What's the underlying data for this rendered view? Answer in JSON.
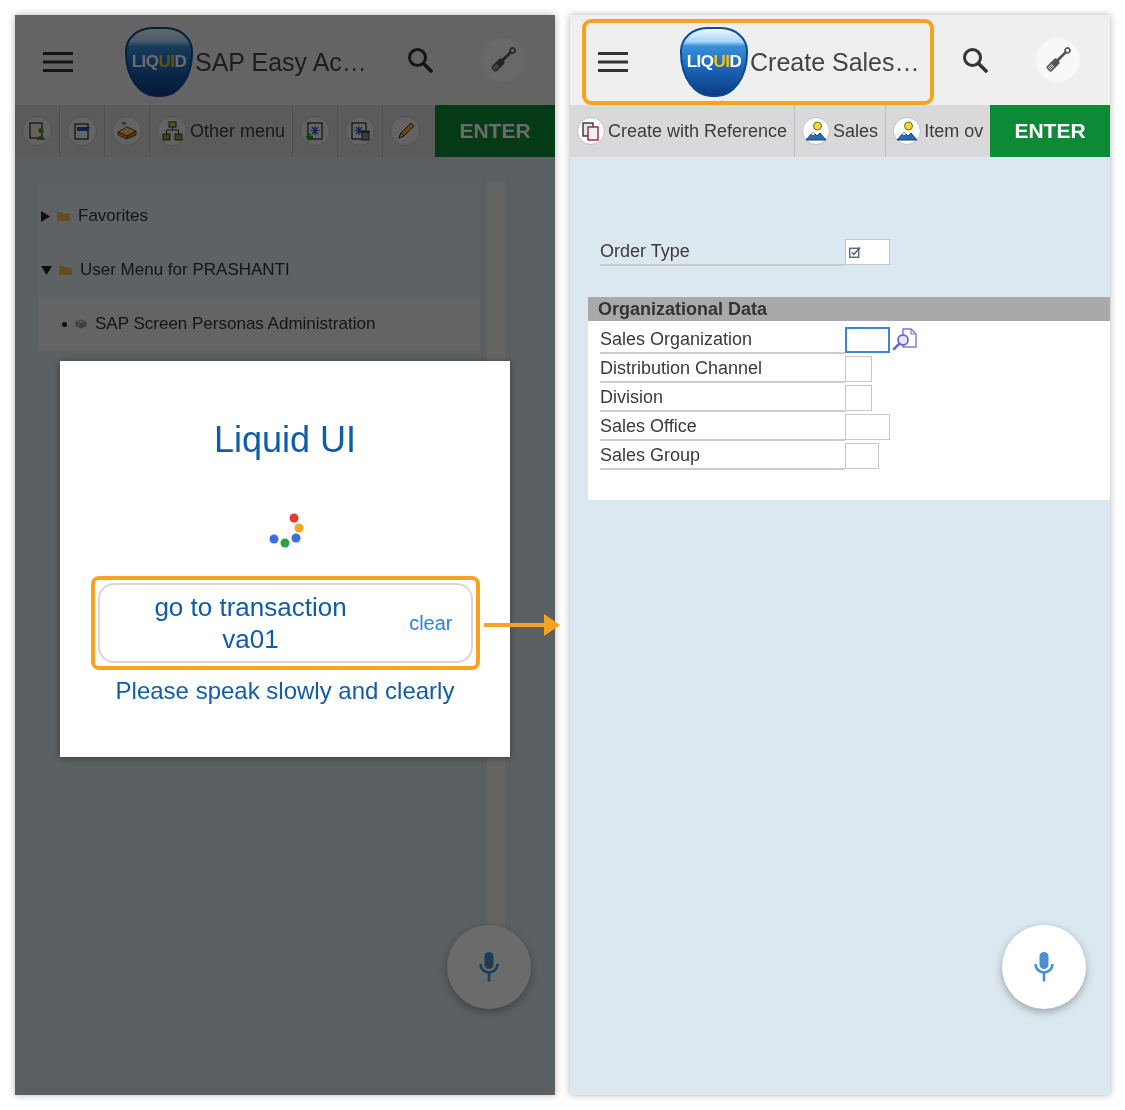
{
  "screens": [
    {
      "kind": "menu",
      "dimmed": true,
      "header": {
        "logo": [
          {
            "text": "LIQ",
            "accent": false
          },
          {
            "text": "UI",
            "accent": true
          },
          {
            "text": "D",
            "accent": false
          }
        ],
        "title": "SAP Easy Ac…",
        "highlighted": false
      },
      "toolbar": {
        "items": [
          {
            "kind": "icon"
          },
          {
            "kind": "icon"
          },
          {
            "kind": "icon"
          },
          {
            "kind": "labeled",
            "label": "Other menu"
          },
          {
            "kind": "icon"
          },
          {
            "kind": "icon"
          },
          {
            "kind": "icon"
          }
        ],
        "enter": "ENTER"
      },
      "tree": [
        {
          "label": "Favorites",
          "expanded": false
        },
        {
          "label": "User Menu for PRASHANTI",
          "expanded": true,
          "children": [
            {
              "label": "SAP Screen Personas Administration"
            }
          ]
        }
      ],
      "dialog": {
        "title": "Liquid UI",
        "transcript": "go to transaction va01",
        "clear": "clear",
        "hint": "Please speak slowly and clearly",
        "highlighted": true
      }
    },
    {
      "kind": "form",
      "dimmed": false,
      "header": {
        "logo": [
          {
            "text": "LIQ",
            "accent": false
          },
          {
            "text": "UI",
            "accent": true
          },
          {
            "text": "D",
            "accent": false
          }
        ],
        "title": "Create Sales…",
        "highlighted": true
      },
      "toolbar": {
        "items": [
          {
            "kind": "labeled",
            "label": "Create with Reference"
          },
          {
            "kind": "labeled",
            "label": "Sales"
          },
          {
            "kind": "labeled",
            "label": "Item ov"
          }
        ],
        "enter": "ENTER"
      },
      "fields": [
        {
          "label": "Order Type",
          "focused": false,
          "required": true
        }
      ],
      "group": {
        "title": "Organizational Data",
        "fields": [
          {
            "label": "Sales Organization",
            "focused": true,
            "value_help": true
          },
          {
            "label": "Distribution Channel",
            "focused": false
          },
          {
            "label": "Division",
            "focused": false
          },
          {
            "label": "Sales Office",
            "focused": false
          },
          {
            "label": "Sales Group",
            "focused": false
          }
        ]
      }
    }
  ]
}
